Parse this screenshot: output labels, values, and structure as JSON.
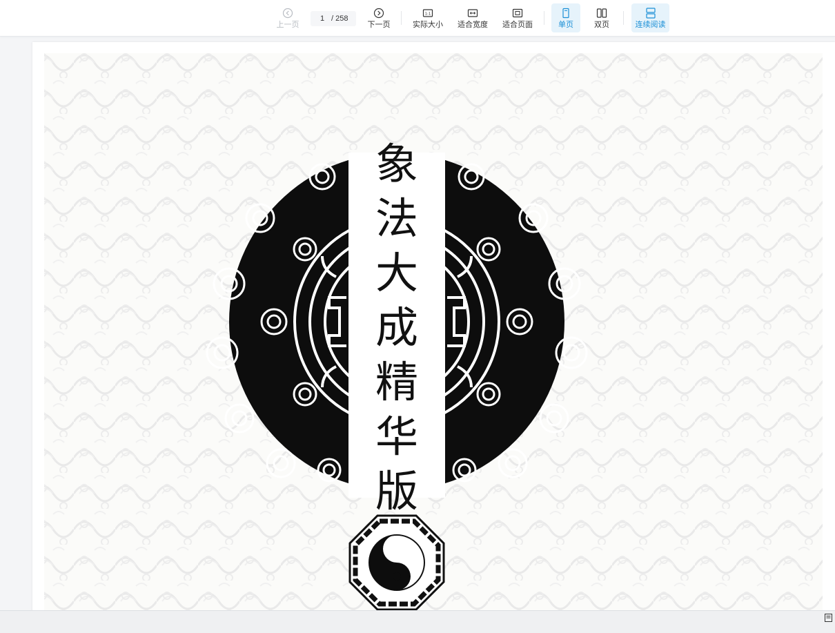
{
  "toolbar": {
    "prev_label": "上一页",
    "next_label": "下一页",
    "current_page": "1",
    "total_pages": "/ 258",
    "actual_size_label": "实际大小",
    "fit_width_label": "适合宽度",
    "fit_page_label": "适合页面",
    "single_page_label": "单页",
    "double_page_label": "双页",
    "continuous_label": "连续阅读",
    "accent_color": "#1a8fd6",
    "icons": [
      "chevron-left-circle-icon",
      "chevron-right-circle-icon",
      "actual-size-icon",
      "fit-width-icon",
      "fit-page-icon",
      "single-page-icon",
      "double-page-icon",
      "continuous-read-icon"
    ]
  },
  "document": {
    "cover_title": [
      "象",
      "法",
      "大",
      "成",
      "精",
      "华",
      "版"
    ]
  }
}
